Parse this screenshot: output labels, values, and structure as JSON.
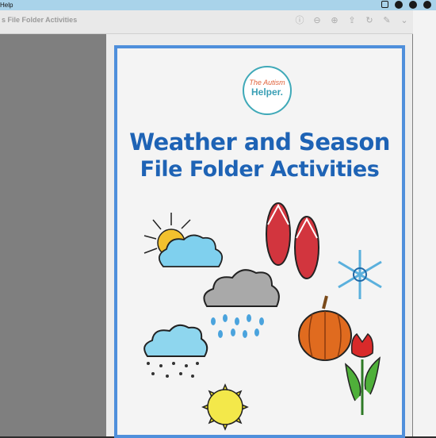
{
  "menubar": {
    "app_name": "Help"
  },
  "toolbar": {
    "title": "s File Folder Activities"
  },
  "document": {
    "logo_line1": "The Autism",
    "logo_line2": "Helper.",
    "title_line1": "Weather and Season",
    "title_line2": "File Folder Activities"
  },
  "colors": {
    "accent": "#4f8fdb",
    "title": "#1e63b5",
    "logo_ring": "#3fa9b8"
  }
}
